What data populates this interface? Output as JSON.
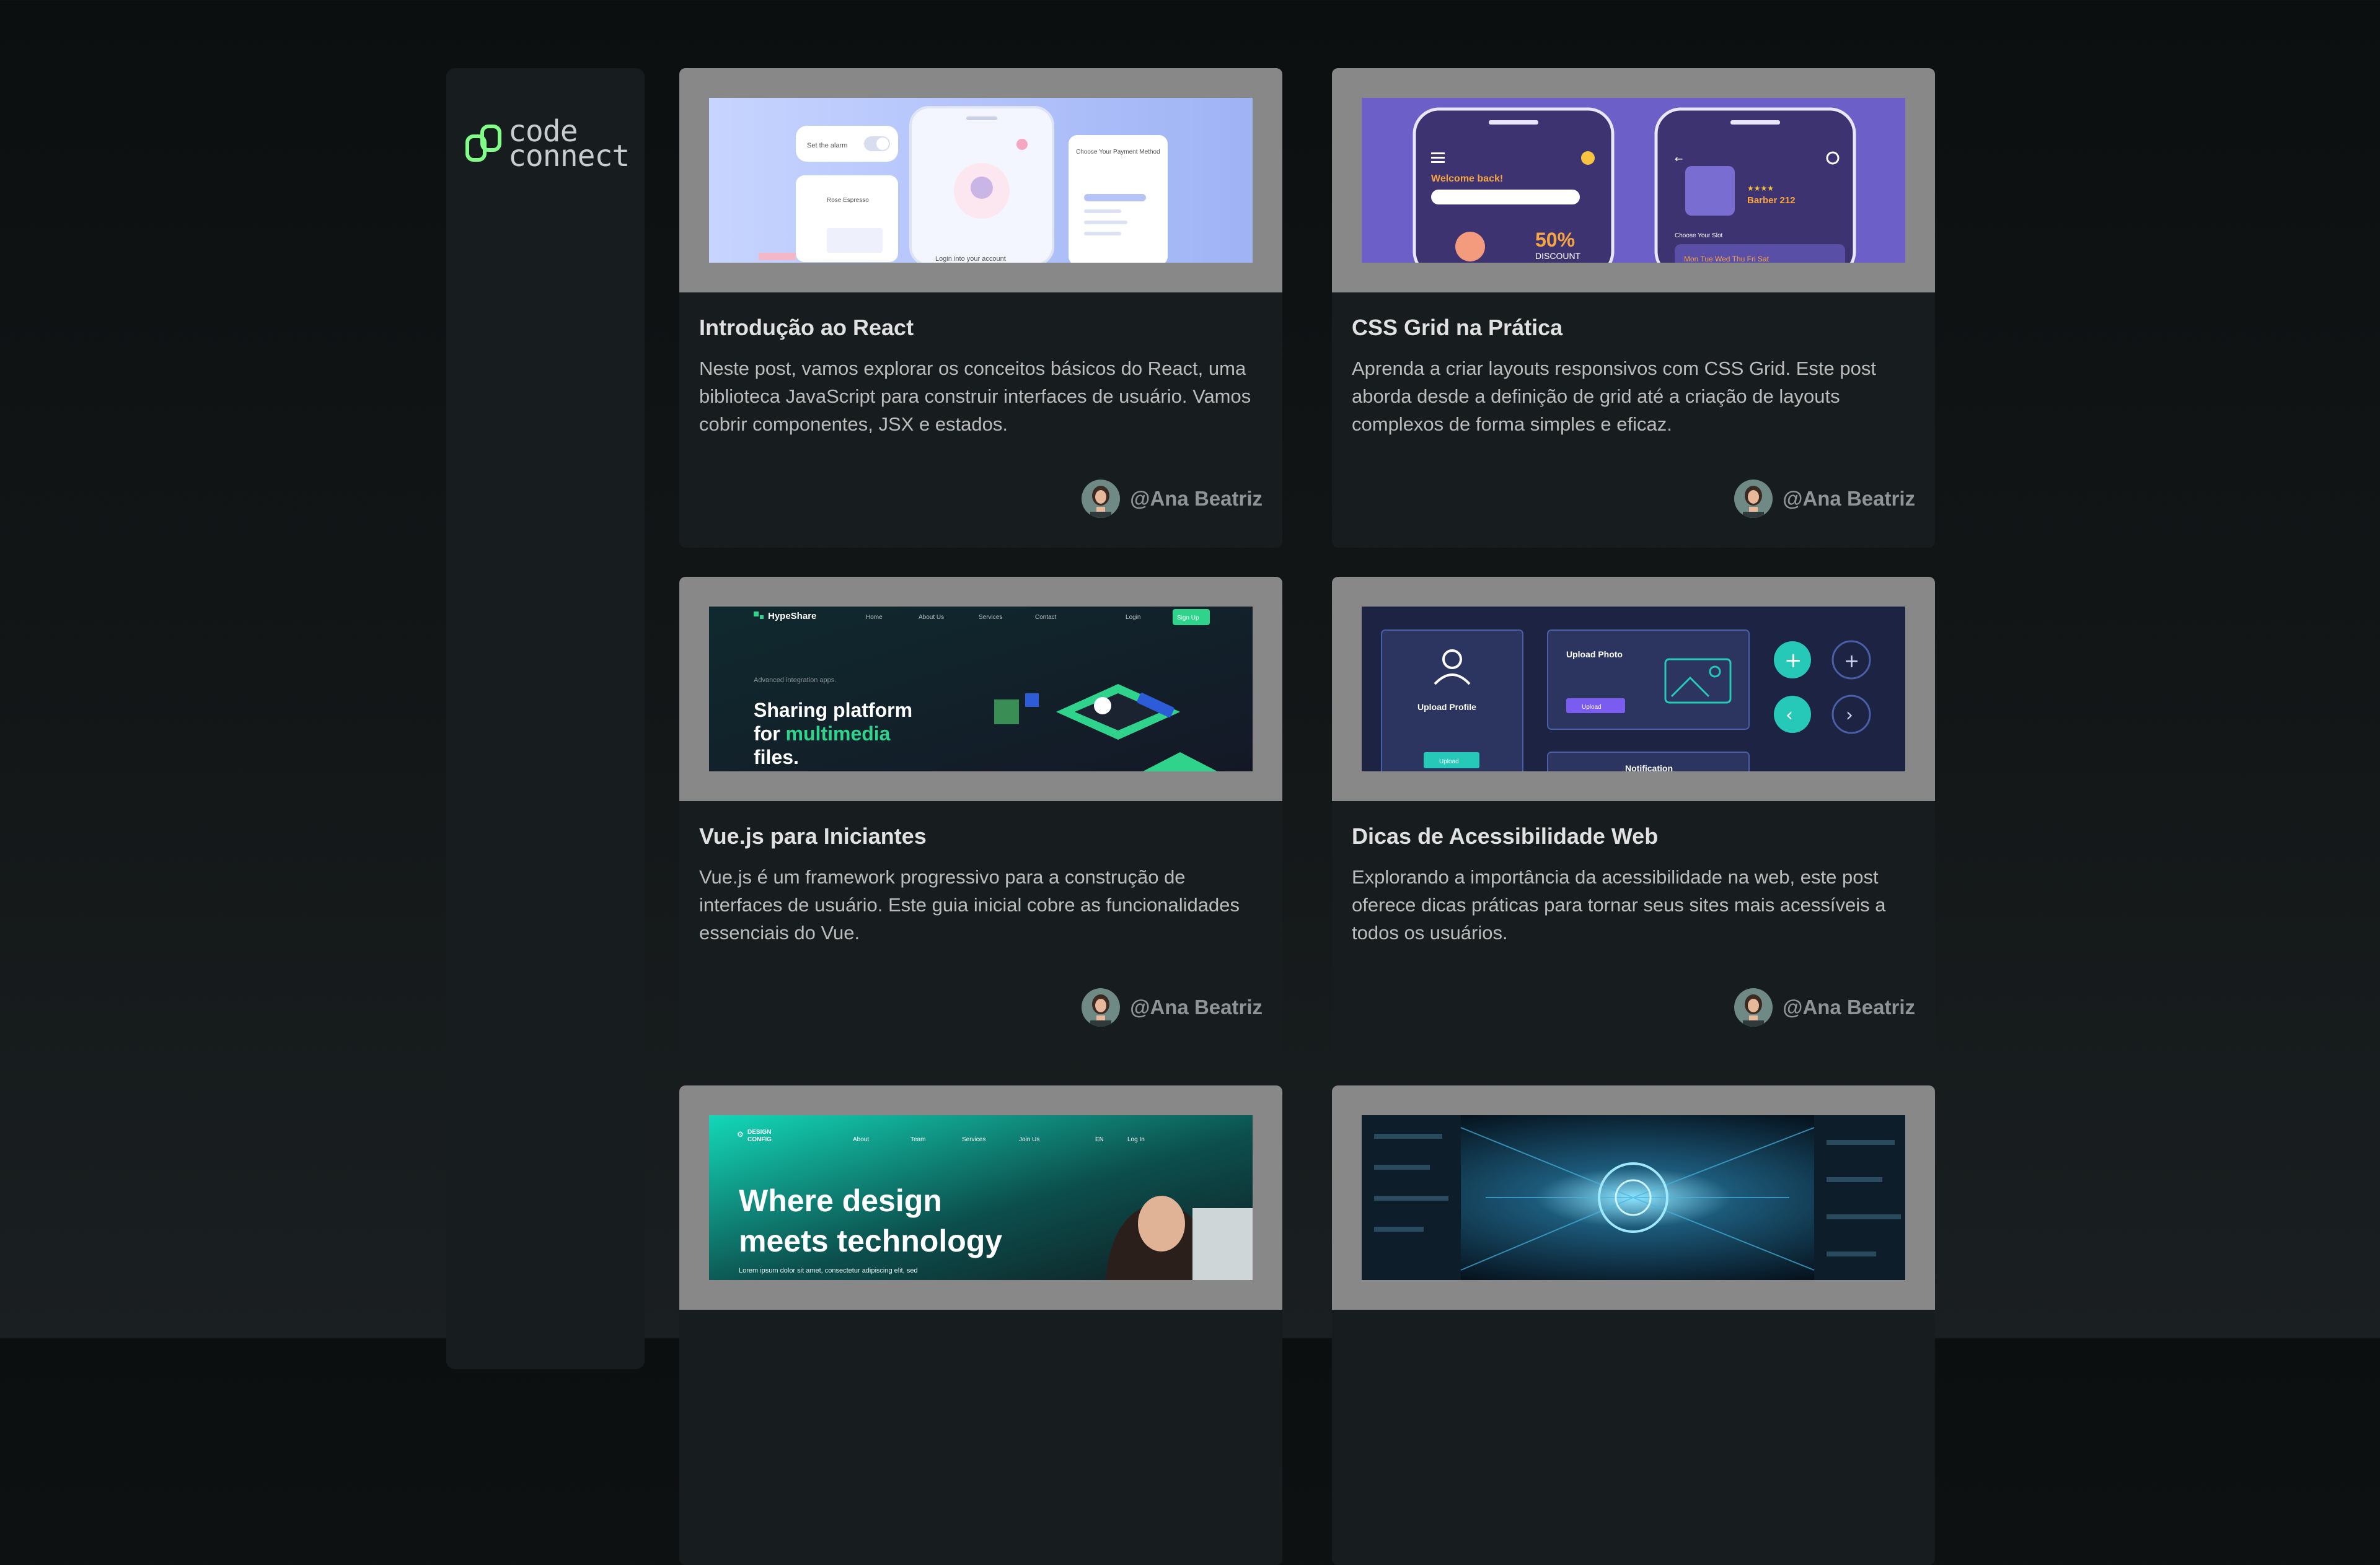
{
  "brand": {
    "line1": "code",
    "line2": "connect",
    "logo_icon": "code-connect-logo-icon",
    "accent": "#81FE88"
  },
  "posts": [
    {
      "title": "Introdução ao React",
      "body": "Neste post, vamos explorar os conceitos básicos do React, uma biblioteca JavaScript para construir interfaces de usuário. Vamos cobrir componentes, JSX e estados.",
      "author": "@Ana Beatriz",
      "thumb": {
        "t1": "Set the alarm",
        "t2": "Rose Espresso",
        "t3": "Choose Your Payment Method",
        "t4": "Login into your account"
      }
    },
    {
      "title": "CSS Grid na Prática",
      "body": "Aprenda a criar layouts responsivos com CSS Grid. Este post aborda desde a definição de grid até a criação de layouts complexos de forma simples e eficaz.",
      "author": "@Ana Beatriz",
      "thumb": {
        "t1": "Welcome back!",
        "t2": "50%",
        "t3": "DISCOUNT",
        "t4": "Barber 212",
        "t5": "Choose Your Slot",
        "t6": "Mon  Tue  Wed  Thu  Fri  Sat"
      }
    },
    {
      "title": "Vue.js para Iniciantes",
      "body": "Vue.js é um framework progressivo para a construção de interfaces de usuário. Este guia inicial cobre as funcionalidades essenciais do Vue.",
      "author": "@Ana Beatriz",
      "thumb": {
        "brand": "HypeShare",
        "n1": "Home",
        "n2": "About Us",
        "n3": "Services",
        "n4": "Contact",
        "n5": "Login",
        "n6": "Sign Up",
        "kicker": "Advanced integration apps.",
        "h1": "Sharing platform",
        "h2a": "for ",
        "h2b": "multimedia",
        "h3": "files."
      }
    },
    {
      "title": "Dicas de Acessibilidade Web",
      "body": "Explorando a importância da acessibilidade na web, este post oferece dicas práticas para tornar seus sites mais acessíveis a todos os usuários.",
      "author": "@Ana Beatriz",
      "thumb": {
        "t1": "Upload Profile",
        "t2": "Upload",
        "t3": "Upload Photo",
        "t4": "Upload",
        "t5": "Notification"
      }
    },
    {
      "title": "",
      "body": "",
      "author": "",
      "thumb": {
        "brand1": "DESIGN",
        "brand2": "CONFIG",
        "n1": "About",
        "n2": "Team",
        "n3": "Services",
        "n4": "Join Us",
        "n5": "EN",
        "n6": "Log In",
        "h1": "Where design",
        "h2": "meets technology",
        "small": "Lorem ipsum dolor sit amet, consectetur adipiscing elit, sed"
      }
    },
    {
      "title": "",
      "body": "",
      "author": "",
      "thumb": {}
    }
  ]
}
